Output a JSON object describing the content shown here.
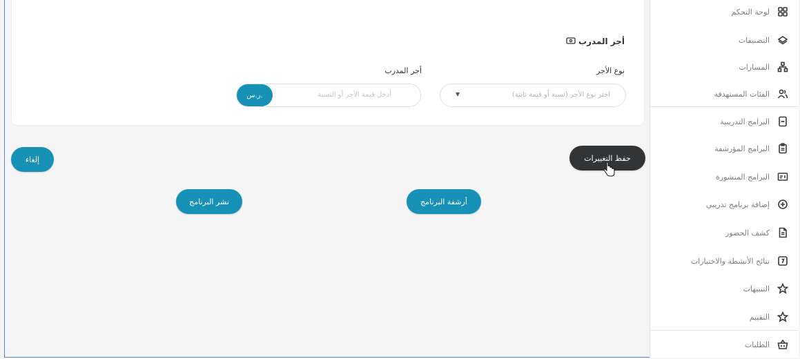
{
  "sidebar": {
    "items": [
      {
        "label": "لوحة التحكم",
        "icon": "grid-icon"
      },
      {
        "label": "التصنيفات",
        "icon": "layers-icon"
      },
      {
        "label": "المسارات",
        "icon": "sitemap-icon"
      },
      {
        "label": "الفئات المستهدفة",
        "icon": "users-icon"
      },
      {
        "label": "البرامج التدريبية",
        "icon": "document-list-icon"
      },
      {
        "label": "البرامج المؤرشفة",
        "icon": "clipboard-icon"
      },
      {
        "label": "البرامج المنشورة",
        "icon": "id-card-icon"
      },
      {
        "label": "إضافة برنامج تدريبي",
        "icon": "plus-circle-icon"
      },
      {
        "label": "كشف الحضور",
        "icon": "file-text-icon"
      },
      {
        "label": "نتائج الأنشطة والاختبارات",
        "icon": "result-file-icon"
      },
      {
        "label": "التنبيهات",
        "icon": "star-icon"
      },
      {
        "label": "التقييم",
        "icon": "star-icon"
      },
      {
        "label": "الطلبات",
        "icon": "basket-icon"
      }
    ]
  },
  "card": {
    "title": "أجر المدرب",
    "wage_type": {
      "label": "نوع الأجر",
      "placeholder": "اختر نوع الأجر (نسبة أو قيمة ثابتة)"
    },
    "trainer_wage": {
      "label": "أجر المدرب",
      "placeholder": "أدخل قيمة الأجر أو النسبة",
      "currency": "ر.س."
    }
  },
  "actions": {
    "save": "حفظ التغييرات",
    "cancel": "إلغاء",
    "archive": "أرشفة البرنامج",
    "publish": "نشر البرنامج"
  },
  "colors": {
    "accent": "#1791b5",
    "dark_button": "#333436"
  }
}
